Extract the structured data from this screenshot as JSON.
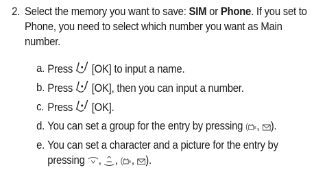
{
  "step": {
    "number": "2.",
    "text_before": "Select the memory you want to save: ",
    "option1": "SIM",
    "or": " or ",
    "option2": "Phone",
    "text_after": ". If you set to Phone, you need to select which number you want as Main number."
  },
  "substeps": [
    {
      "label": "a.",
      "before": "Press ",
      "key": "[OK]",
      "after": " to input a name."
    },
    {
      "label": "b.",
      "before": "Press ",
      "key": "[OK]",
      "after": ", then you can input a number."
    },
    {
      "label": "c.",
      "before": "Press ",
      "key": "[OK]",
      "after": "."
    },
    {
      "label": "d.",
      "text": "You can set a group for the entry by pressing",
      "end": ")."
    },
    {
      "label": "e.",
      "text": "You can set a character and a picture for the entry by pressing",
      "sep1": ",",
      "sep2": ",",
      "end": ")."
    }
  ]
}
